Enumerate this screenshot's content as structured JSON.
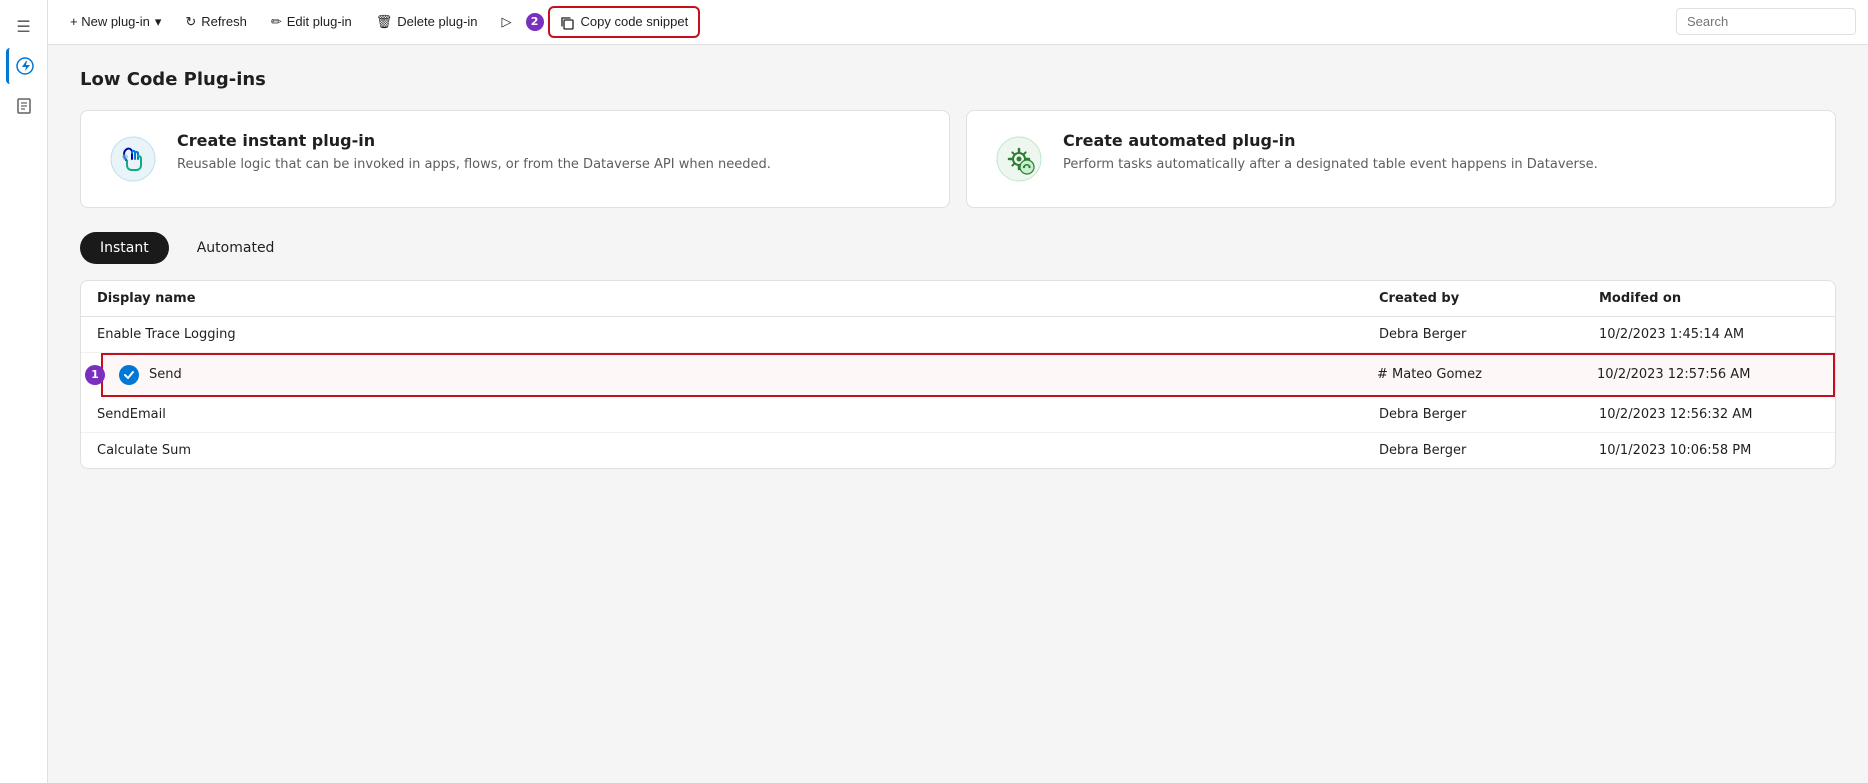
{
  "sidebar": {
    "icons": [
      {
        "name": "hamburger-icon",
        "symbol": "☰"
      },
      {
        "name": "lightning-icon",
        "symbol": "⚡",
        "active": true
      },
      {
        "name": "book-icon",
        "symbol": "📖"
      }
    ]
  },
  "toolbar": {
    "new_plugin_label": "+ New plug-in",
    "refresh_label": "Refresh",
    "edit_plugin_label": "Edit plug-in",
    "delete_plugin_label": "Delete plug-in",
    "run_label": "▷",
    "copy_snippet_label": "Copy code snippet",
    "copy_badge": "2",
    "search_placeholder": "Search"
  },
  "page": {
    "title": "Low Code Plug-ins"
  },
  "cards": [
    {
      "id": "instant",
      "title": "Create instant plug-in",
      "description": "Reusable logic that can be invoked in apps, flows, or from the Dataverse API when needed."
    },
    {
      "id": "automated",
      "title": "Create automated plug-in",
      "description": "Perform tasks automatically after a designated table event happens in Dataverse."
    }
  ],
  "tabs": [
    {
      "label": "Instant",
      "active": true
    },
    {
      "label": "Automated",
      "active": false
    }
  ],
  "table": {
    "columns": [
      {
        "label": "Display name"
      },
      {
        "label": "Created by"
      },
      {
        "label": "Modifed on"
      }
    ],
    "rows": [
      {
        "display_name": "Enable Trace Logging",
        "created_by": "Debra Berger",
        "modified_on": "10/2/2023 1:45:14 AM",
        "selected": false,
        "row_number": null
      },
      {
        "display_name": "Send",
        "created_by": "# Mateo Gomez",
        "modified_on": "10/2/2023 12:57:56 AM",
        "selected": true,
        "row_number": "1",
        "checked": true
      },
      {
        "display_name": "SendEmail",
        "created_by": "Debra Berger",
        "modified_on": "10/2/2023 12:56:32 AM",
        "selected": false,
        "row_number": null
      },
      {
        "display_name": "Calculate Sum",
        "created_by": "Debra Berger",
        "modified_on": "10/1/2023 10:06:58 PM",
        "selected": false,
        "row_number": null
      }
    ]
  }
}
